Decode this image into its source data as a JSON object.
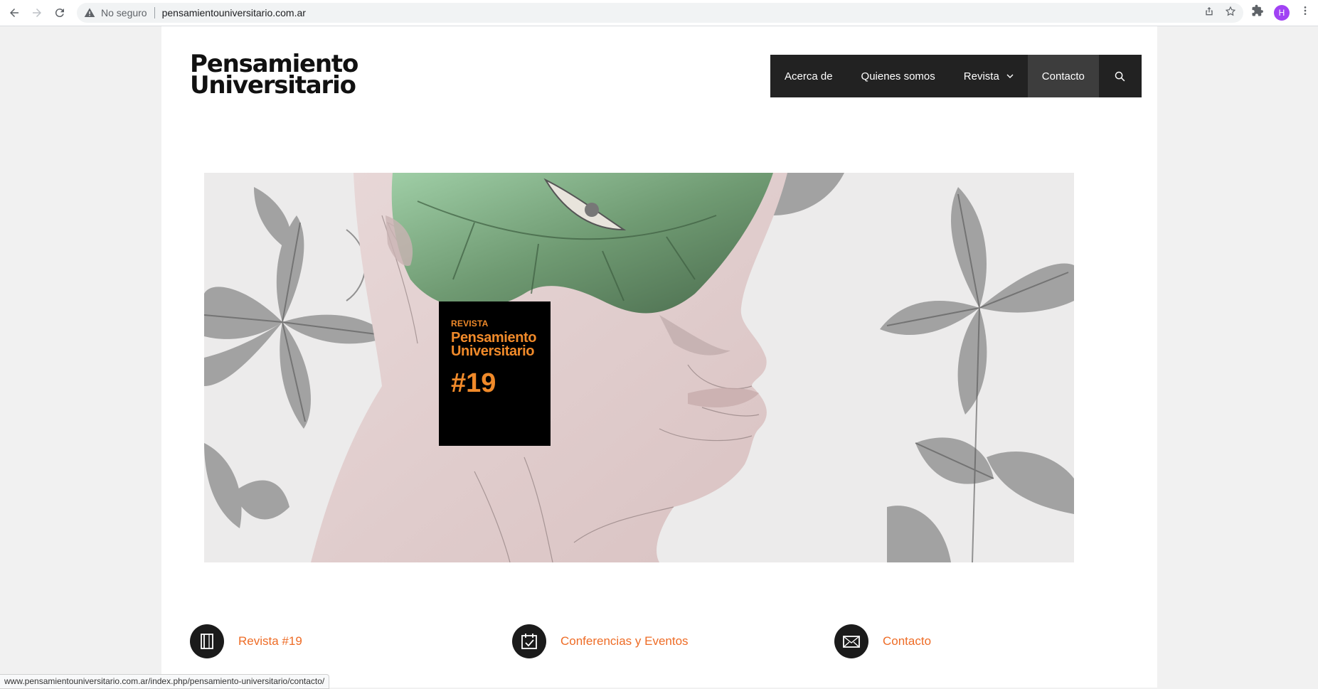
{
  "browser": {
    "security_label": "No seguro",
    "url": "pensamientouniversitario.com.ar",
    "profile_initial": "H",
    "status_url": "www.pensamientouniversitario.com.ar/index.php/pensamiento-universitario/contacto/"
  },
  "site": {
    "logo_line1": "Pensamiento",
    "logo_line2": "Universitario"
  },
  "nav": {
    "items": [
      {
        "label": "Acerca de"
      },
      {
        "label": "Quienes somos"
      },
      {
        "label": "Revista",
        "has_dropdown": true
      },
      {
        "label": "Contacto",
        "active": true
      }
    ],
    "search_icon": "search-icon"
  },
  "hero": {
    "cover_small": "REVISTA",
    "cover_title_line1": "Pensamiento",
    "cover_title_line2": "Universitario",
    "cover_number": "#19"
  },
  "features": [
    {
      "label": "Revista #19",
      "icon": "book-icon"
    },
    {
      "label": "Conferencias y Eventos",
      "icon": "calendar-check-icon"
    },
    {
      "label": "Contacto",
      "icon": "envelope-icon"
    }
  ],
  "colors": {
    "accent": "#ee6c26",
    "nav_bg": "#222222",
    "nav_active": "#3d3d3d",
    "cover_text": "#f08a2a"
  }
}
